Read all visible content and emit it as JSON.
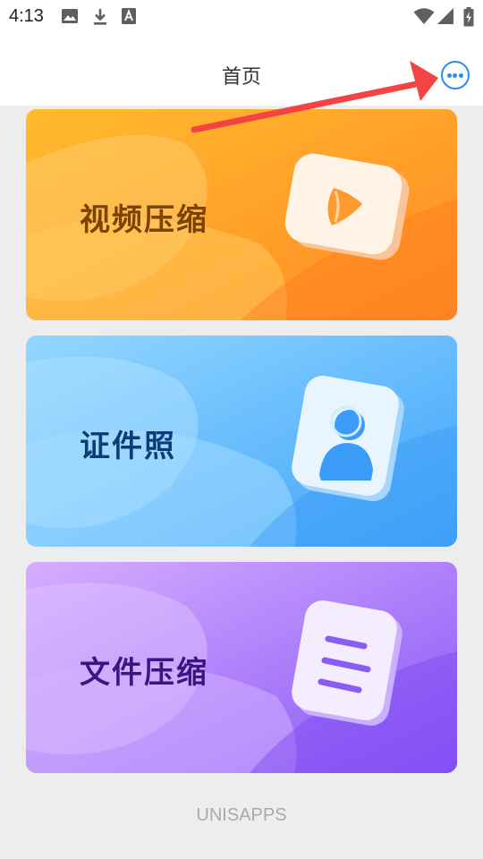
{
  "status_bar": {
    "time": "4:13",
    "icons": [
      "image-icon",
      "download-icon",
      "a-badge-icon",
      "wifi-icon",
      "cellular-signal-icon",
      "battery-charging-icon"
    ]
  },
  "header": {
    "title": "首页",
    "more_icon": "more-horizontal-icon",
    "accent_color": "#2d8cf0"
  },
  "annotation": {
    "arrow_color": "#f24444"
  },
  "cards": [
    {
      "label": "视频压缩",
      "icon": "video-play-icon",
      "label_color": "#7a4300",
      "gradient": [
        "#ffb429",
        "#ff8a24"
      ]
    },
    {
      "label": "证件照",
      "icon": "id-photo-person-icon",
      "label_color": "#0b3d79",
      "gradient": [
        "#8fd2fd",
        "#40a6fb"
      ]
    },
    {
      "label": "文件压缩",
      "icon": "document-icon",
      "label_color": "#3c1484",
      "gradient": [
        "#cfa5ff",
        "#8d5bf8"
      ]
    }
  ],
  "footer": {
    "text": "UNISAPPS"
  }
}
